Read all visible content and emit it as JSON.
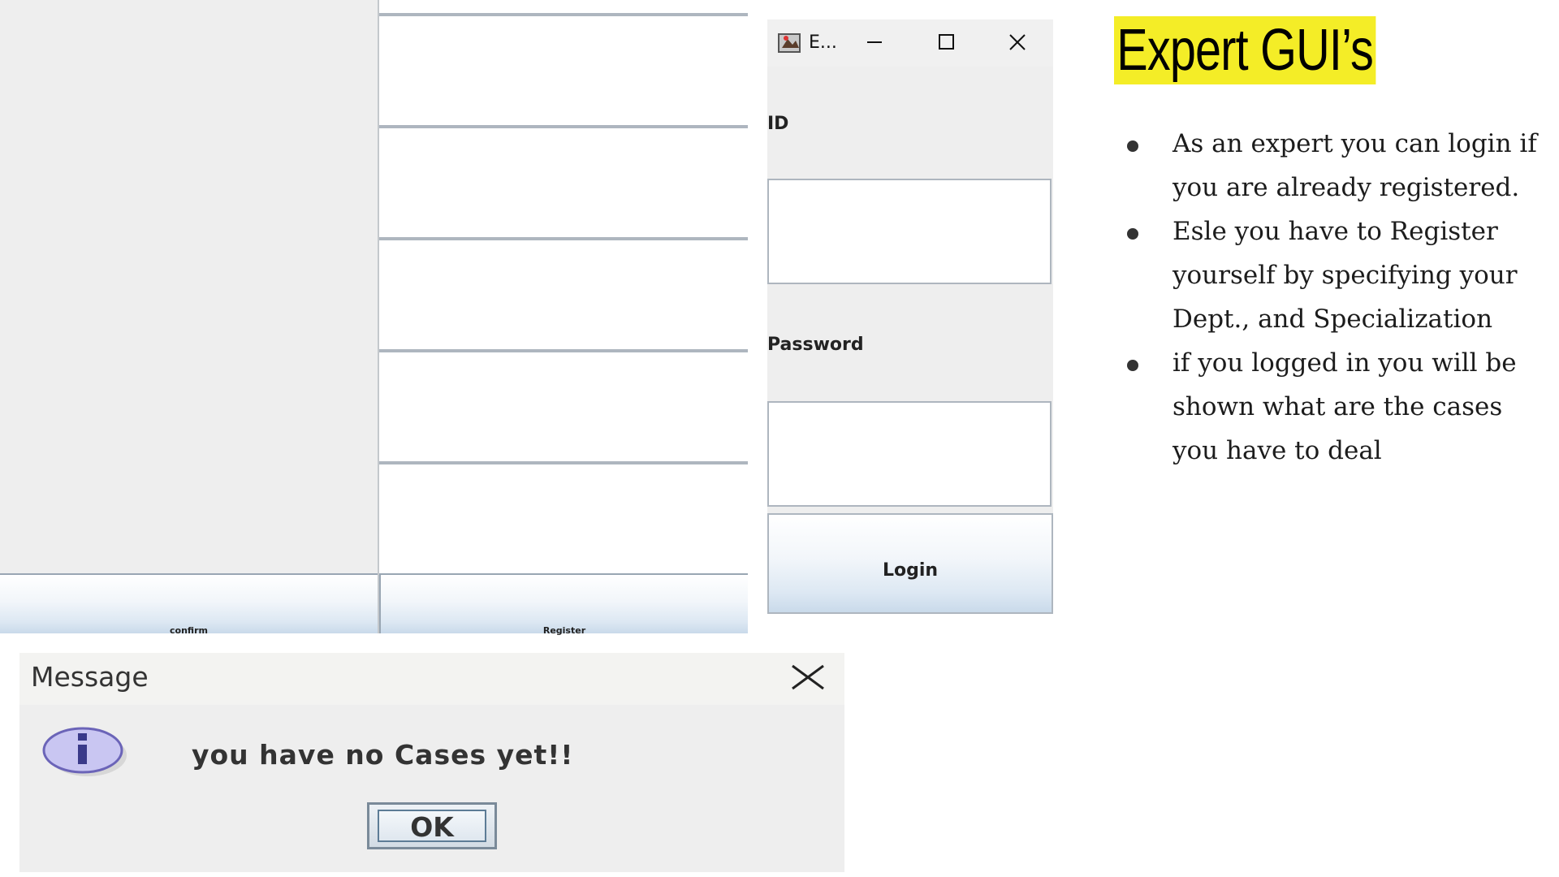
{
  "registration": {
    "confirm_label": "confirm",
    "register_label": "Register"
  },
  "login_window": {
    "title": "E...",
    "id_label": "ID",
    "password_label": "Password",
    "login_label": "Login"
  },
  "message_dialog": {
    "title": "Message",
    "text": "you have no Cases yet!!",
    "ok_label": "OK",
    "icon": "info-icon"
  },
  "slide": {
    "title": "Expert GUI’s",
    "title_highlight": "#f4ed27",
    "bullets": [
      "As an expert you can login if you are already registered.",
      "Esle you have to Register yourself by specifying your Dept., and Specialization",
      "if you logged in you will be shown what are the cases you have to deal"
    ]
  }
}
